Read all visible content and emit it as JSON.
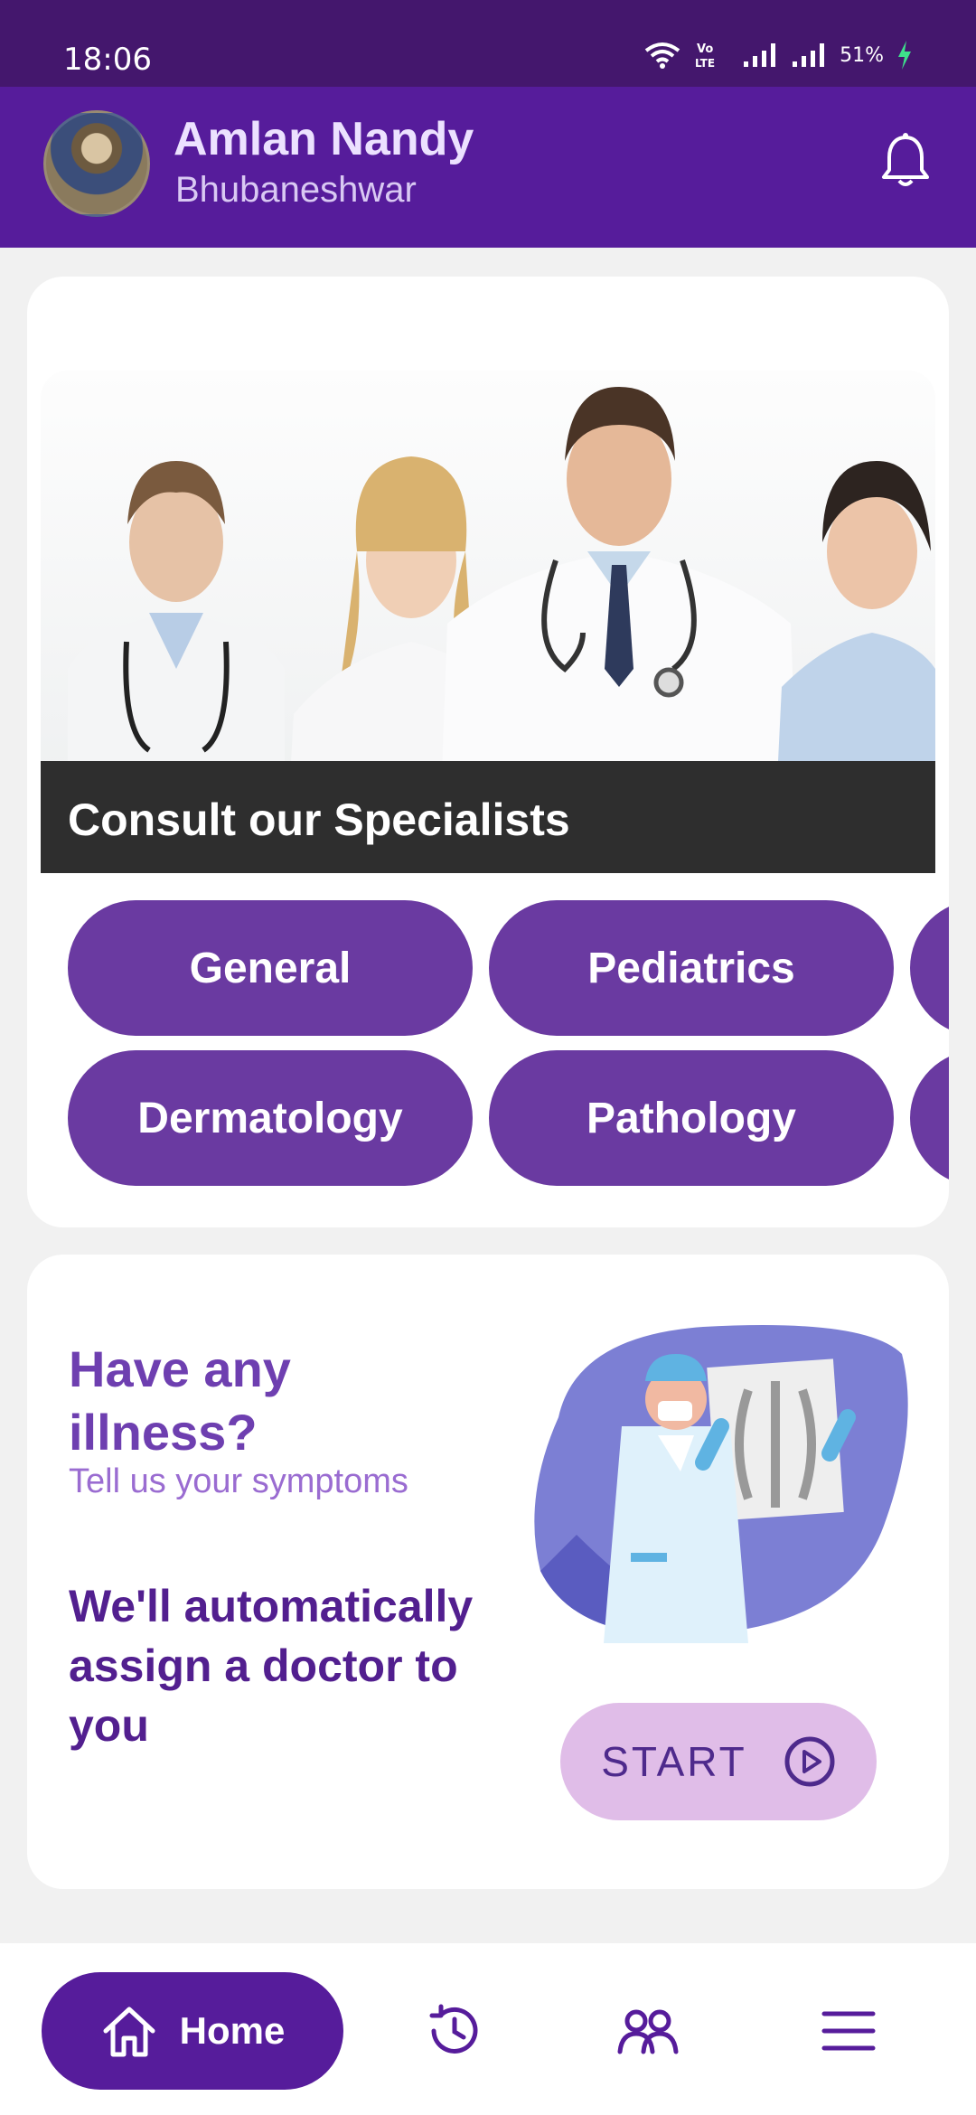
{
  "status": {
    "time": "18:06",
    "battery": "51%",
    "icons": [
      "wifi-icon",
      "volte-icon",
      "signal-icon",
      "signal-icon",
      "charging-icon"
    ]
  },
  "header": {
    "name": "Amlan Nandy",
    "city": "Bhubaneshwar",
    "notification_icon": "bell-icon"
  },
  "specialists": {
    "caption": "Consult our Specialists",
    "row1": [
      "General",
      "Pediatrics"
    ],
    "row2": [
      "Dermatology",
      "Pathology"
    ]
  },
  "symptoms": {
    "title": "Have any illness?",
    "subtitle": "Tell us your symptoms",
    "assign": "We'll automatically assign a doctor to you",
    "start_label": "START"
  },
  "nav": {
    "home": "Home",
    "icons": [
      "home-icon",
      "history-icon",
      "people-icon",
      "menu-icon"
    ]
  },
  "colors": {
    "primary": "#561c9b",
    "chip": "#6a3aa1",
    "start_bg": "#e0bde8"
  }
}
